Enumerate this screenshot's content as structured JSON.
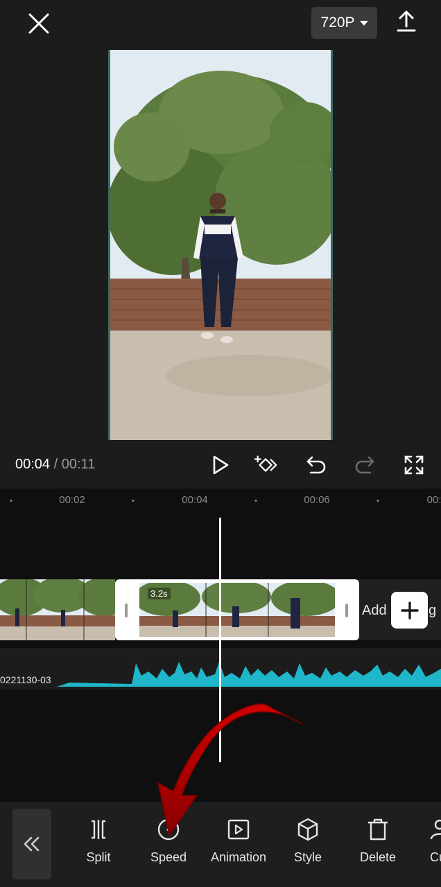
{
  "header": {
    "resolution": "720P"
  },
  "player": {
    "current_time": "00:04",
    "separator": "/",
    "total_time": "00:11"
  },
  "timeline": {
    "ruler_labels": [
      "00:02",
      "00:04",
      "00:06",
      "00:"
    ],
    "clip_speed_badge": "3.2s",
    "add_ending_label": "Add",
    "add_ending_tail": "g",
    "audio_track_name": "0221130-03"
  },
  "toolbar": {
    "tools": [
      {
        "label": "Split",
        "icon": "split-icon"
      },
      {
        "label": "Speed",
        "icon": "speed-icon"
      },
      {
        "label": "Animation",
        "icon": "animation-icon"
      },
      {
        "label": "Style",
        "icon": "style-icon"
      },
      {
        "label": "Delete",
        "icon": "delete-icon"
      },
      {
        "label": "Cu",
        "icon": "cutout-icon"
      }
    ]
  },
  "colors": {
    "accent_waveform": "#1fb6c9",
    "annotation_arrow": "#c00000"
  }
}
